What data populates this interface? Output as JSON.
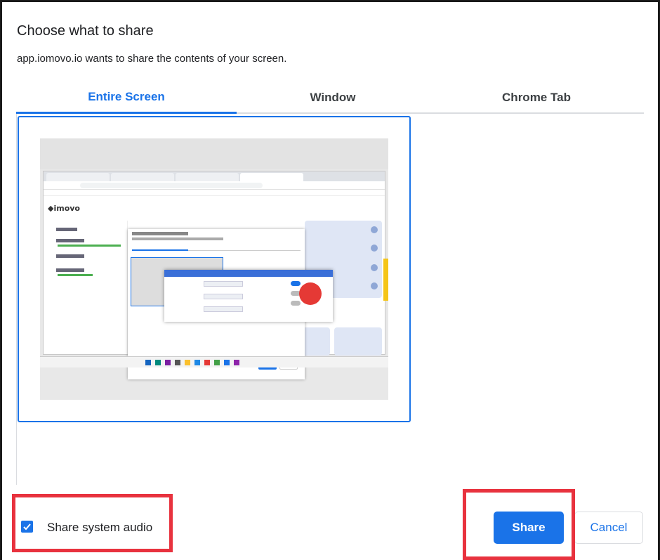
{
  "dialog": {
    "title": "Choose what to share",
    "subtitle": "app.iomovo.io wants to share the contents of your screen."
  },
  "tabs": [
    {
      "label": "Entire Screen",
      "selected": true
    },
    {
      "label": "Window",
      "selected": false
    },
    {
      "label": "Chrome Tab",
      "selected": false
    }
  ],
  "footer": {
    "audio_label": "Share system audio",
    "audio_checked": true,
    "share_label": "Share",
    "cancel_label": "Cancel"
  },
  "colors": {
    "accent": "#1a73e8",
    "highlight": "#e8323e"
  }
}
